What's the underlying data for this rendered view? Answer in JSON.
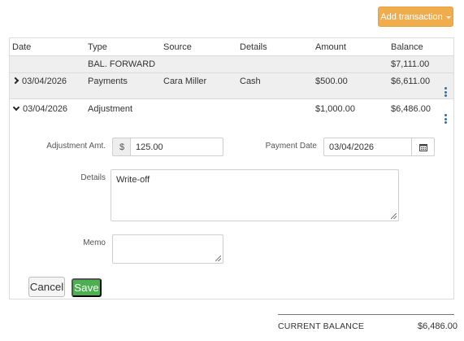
{
  "toolbar": {
    "add_transaction_label": "Add transaction"
  },
  "table": {
    "headers": {
      "date": "Date",
      "type": "Type",
      "source": "Source",
      "details": "Details",
      "amount": "Amount",
      "balance": "Balance"
    },
    "rows": [
      {
        "date": "",
        "type": "BAL. FORWARD",
        "source": "",
        "details": "",
        "amount": "",
        "balance": "$7,111.00"
      },
      {
        "date": "03/04/2026",
        "type": "Payments",
        "source": "Cara Miller",
        "details": "Cash",
        "amount": "$500.00",
        "balance": "$6,611.00",
        "expanded": false
      },
      {
        "date": "03/04/2026",
        "type": "Adjustment",
        "source": "",
        "details": "",
        "amount": "$1,000.00",
        "balance": "$6,486.00",
        "expanded": true
      }
    ]
  },
  "form": {
    "adjustment_label": "Adjustment Amt.",
    "currency_symbol": "$",
    "adjustment_value": "125.00",
    "payment_date_label": "Payment Date",
    "payment_date_value": "03/04/2026",
    "details_label": "Details",
    "details_value": "Write-off",
    "memo_label": "Memo",
    "memo_value": "",
    "cancel_label": "Cancel",
    "save_label": "Save"
  },
  "footer": {
    "current_balance_label": "CURRENT BALANCE",
    "current_balance_value": "$6,486.00"
  },
  "colors": {
    "accent": "#f0ad4e",
    "save": "#4caf50",
    "menu_dots": "#2a6fb5",
    "row_bg": "#efefef"
  },
  "icons": {
    "expand": "chevron-right-icon",
    "collapse": "chevron-down-icon",
    "row_menu": "kebab-menu-icon",
    "date_picker": "calendar-icon",
    "add_dropdown": "caret-down-icon"
  }
}
